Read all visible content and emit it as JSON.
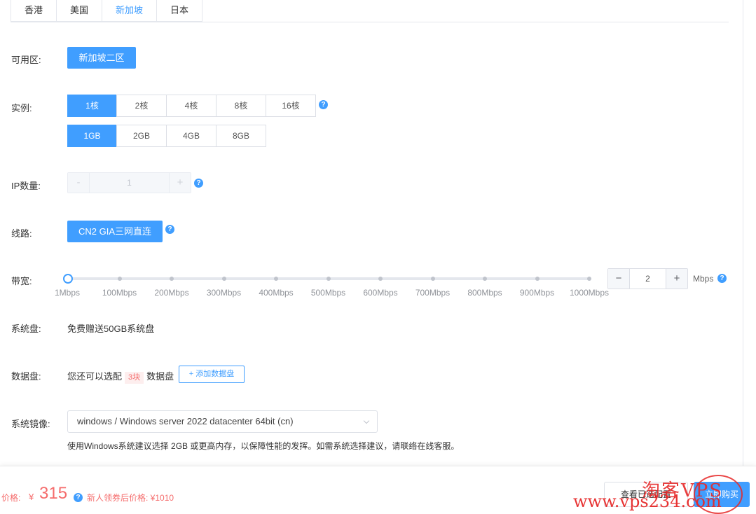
{
  "tabs": [
    {
      "label": "香港",
      "active": false
    },
    {
      "label": "美国",
      "active": false
    },
    {
      "label": "新加坡",
      "active": true
    },
    {
      "label": "日本",
      "active": false
    }
  ],
  "zone": {
    "label": "可用区:",
    "value": "新加坡二区"
  },
  "instance": {
    "label": "实例:",
    "cpu": [
      "1核",
      "2核",
      "4核",
      "8核",
      "16核"
    ],
    "cpu_selected": "1核",
    "ram": [
      "1GB",
      "2GB",
      "4GB",
      "8GB"
    ],
    "ram_selected": "1GB"
  },
  "ip": {
    "label": "IP数量:",
    "minus": "-",
    "value": "1",
    "plus": "+"
  },
  "line": {
    "label": "线路:",
    "value": "CN2 GIA三网直连"
  },
  "bandwidth": {
    "label": "带宽:",
    "ticks": [
      "1Mbps",
      "100Mbps",
      "200Mbps",
      "300Mbps",
      "400Mbps",
      "500Mbps",
      "600Mbps",
      "700Mbps",
      "800Mbps",
      "900Mbps",
      "1000Mbps"
    ],
    "slider_value_mbps": 2,
    "slider_max_mbps": 1000,
    "minus": "−",
    "value": "2",
    "plus": "+",
    "unit": "Mbps"
  },
  "system_disk": {
    "label": "系统盘:",
    "text": "免费赠送50GB系统盘"
  },
  "data_disk": {
    "label": "数据盘:",
    "prefix": "您还可以选配",
    "count": "3块",
    "suffix": "数据盘",
    "add_button": "+ 添加数据盘"
  },
  "image": {
    "label": "系统镜像:",
    "selected": "windows / Windows server 2022 datacenter 64bit (cn)",
    "hint": "使用Windows系统建议选择 2GB 或更高内存，以保障性能的发挥。如需系统选择建议，请联络在线客服。"
  },
  "footer": {
    "price_label": "价格:",
    "currency": "¥",
    "price": "315",
    "coupon_text": "新人领券后价格: ¥1010",
    "view_config_button": "查看已选配置",
    "buy_button": "立即购买"
  },
  "watermark": {
    "cn": "淘客VPS",
    "url": "www.vps234.com"
  },
  "colors": {
    "primary": "#409eff",
    "price": "#f56c6c",
    "border": "#dcdfe6"
  }
}
